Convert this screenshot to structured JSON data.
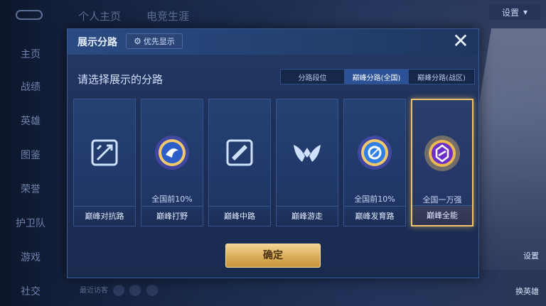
{
  "background": {
    "sidebar_items": [
      "主页",
      "战绩",
      "英雄",
      "图鉴",
      "荣誉",
      "护卫队",
      "游戏",
      "社交"
    ],
    "top_tabs": [
      "个人主页",
      "电竞生涯"
    ],
    "settings_label": "设置",
    "right_buttons": [
      "设置",
      "换英雄"
    ],
    "recent_visitors_label": "最近访客"
  },
  "dialog": {
    "title": "展示分路",
    "priority_label": "优先显示",
    "subtitle": "请选择展示的分路",
    "tabs": [
      {
        "label": "分路段位",
        "active": false
      },
      {
        "label": "巅峰分路(全国)",
        "active": true
      },
      {
        "label": "巅峰分路(战区)",
        "active": false
      }
    ],
    "cards": [
      {
        "label": "巅峰对抗路",
        "rank": "",
        "icon": "clash-lane-icon",
        "selected": false
      },
      {
        "label": "巅峰打野",
        "rank": "全国前10%",
        "icon": "jungle-badge-icon",
        "selected": false
      },
      {
        "label": "巅峰中路",
        "rank": "",
        "icon": "mid-lane-icon",
        "selected": false
      },
      {
        "label": "巅峰游走",
        "rank": "",
        "icon": "roam-icon",
        "selected": false
      },
      {
        "label": "巅峰发育路",
        "rank": "全国前10%",
        "icon": "farm-lane-badge-icon",
        "selected": false
      },
      {
        "label": "巅峰全能",
        "rank": "全国一万强",
        "icon": "all-round-badge-icon",
        "selected": true
      }
    ],
    "confirm_label": "确定"
  },
  "colors": {
    "accent_gold": "#f0c36a",
    "active_tab": "#2b5297",
    "panel": "#1d3058"
  }
}
